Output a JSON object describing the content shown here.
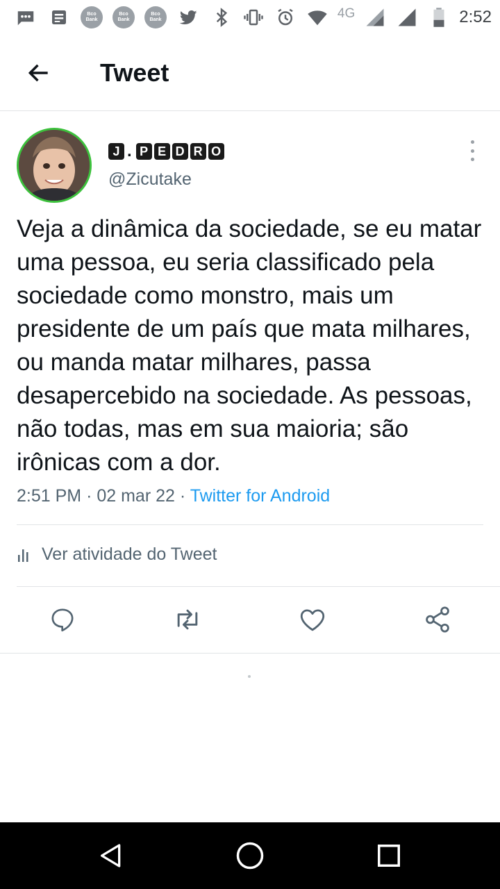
{
  "status_bar": {
    "time": "2:52",
    "network_label": "4G",
    "icons": [
      "messages-icon",
      "news-icon",
      "bank-app-icon",
      "bank-app-icon",
      "bank-app-icon",
      "twitter-icon",
      "bluetooth-icon",
      "vibrate-icon",
      "alarm-icon",
      "wifi-icon",
      "signal-icon",
      "signal-icon",
      "battery-icon"
    ],
    "bank_badge_text": "Bco Bank"
  },
  "header": {
    "title": "Tweet",
    "back_icon": "arrow-left-icon"
  },
  "tweet": {
    "display_name_prefix": "J",
    "display_name_dot": ".",
    "display_name_letters": [
      "P",
      "E",
      "D",
      "R",
      "O"
    ],
    "handle": "@Zicutake",
    "text": "Veja a dinâmica da sociedade, se eu matar uma pessoa, eu seria classificado pela sociedade como monstro, mais um presidente de um país que mata milhares, ou manda matar milhares, passa desapercebido na sociedade. As pessoas, não todas, mas em sua maioria; são irônicas com a dor.",
    "time": "2:51 PM",
    "separator": "·",
    "date": "02 mar 22",
    "source": "Twitter for Android"
  },
  "activity": {
    "label": "Ver atividade do Tweet",
    "icon": "bar-chart-icon"
  },
  "actions": {
    "icons": [
      "reply-icon",
      "retweet-icon",
      "like-icon",
      "share-icon"
    ]
  },
  "nav": {
    "icons": [
      "back-triangle-icon",
      "home-circle-icon",
      "recents-square-icon"
    ]
  },
  "colors": {
    "link": "#1d9bf0",
    "secondary_text": "#536471",
    "avatar_ring": "#3cc13c"
  }
}
